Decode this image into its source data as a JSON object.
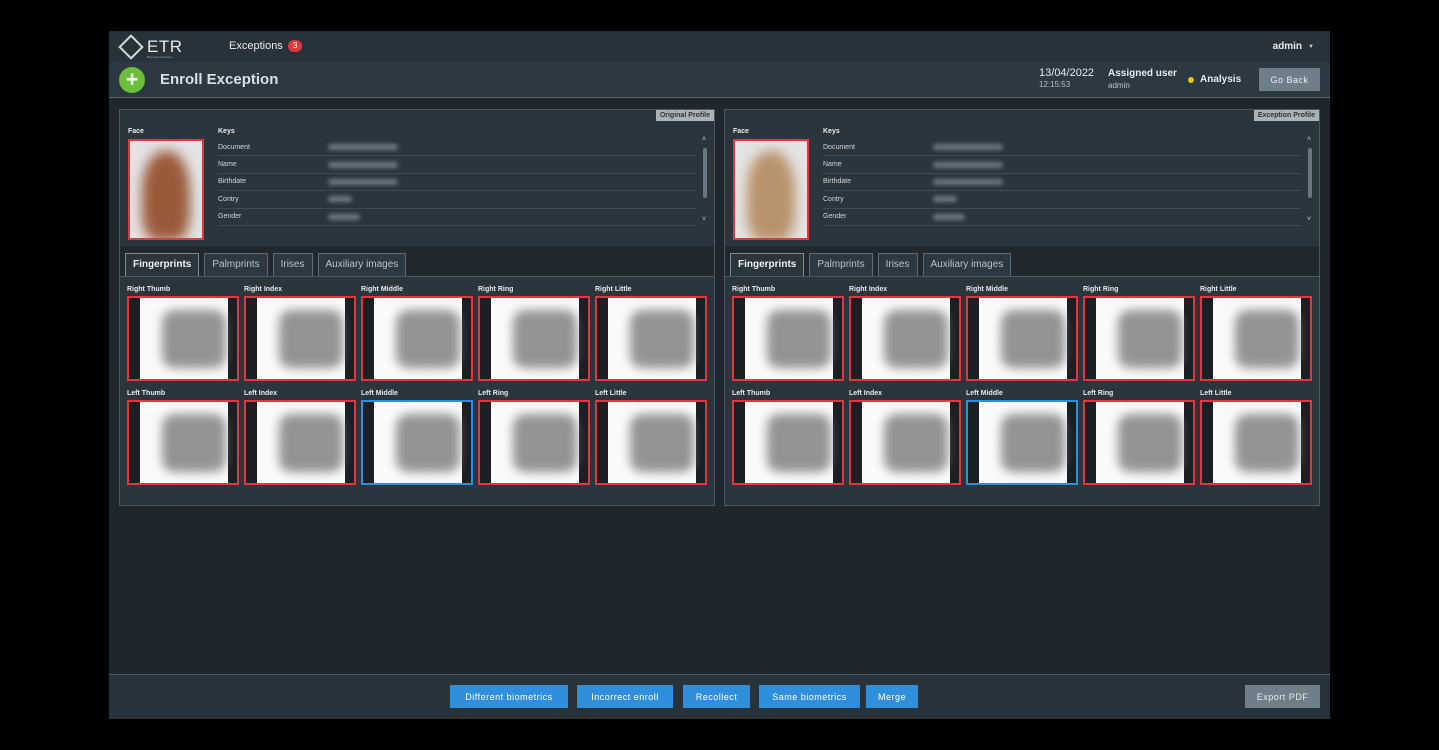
{
  "topbar": {
    "logo_text": "ETR",
    "logo_subtext": "Biometric Solutions",
    "nav_label": "Exceptions",
    "nav_badge": "3",
    "user": "admin"
  },
  "header": {
    "title": "Enroll Exception",
    "date": "13/04/2022",
    "time": "12:15:53",
    "assigned_label": "Assigned user",
    "assigned_value": "admin",
    "status": "Analysis",
    "status_color": "#f1c40f",
    "go_back": "Go Back"
  },
  "labels": {
    "face": "Face",
    "keys": "Keys",
    "key_fields": [
      "Document",
      "Name",
      "Birthdate",
      "Contry",
      "Gender"
    ]
  },
  "tabs": [
    "Fingerprints",
    "Palmprints",
    "Irises",
    "Auxiliary images"
  ],
  "fingers": {
    "right": [
      "Right Thumb",
      "Right Index",
      "Right Middle",
      "Right Ring",
      "Right Little"
    ],
    "left": [
      "Left Thumb",
      "Left Index",
      "Left Middle",
      "Left Ring",
      "Left Little"
    ]
  },
  "profiles": [
    {
      "tag": "Original Profile"
    },
    {
      "tag": "Exception Profile"
    }
  ],
  "footer": {
    "buttons": [
      "Different biometrics",
      "Incorrect enroll",
      "Recollect",
      "Same biometrics",
      "Merge"
    ],
    "export": "Export PDF"
  },
  "colors": {
    "accent": "#2f8fdc",
    "alert": "#e0383e",
    "add": "#6bbf3b"
  }
}
